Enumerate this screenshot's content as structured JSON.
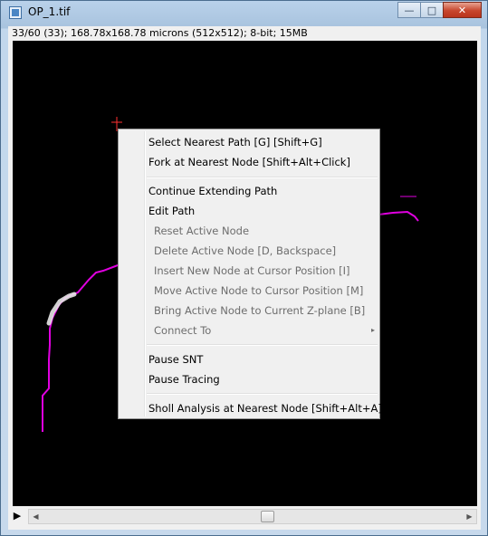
{
  "window": {
    "title": "OP_1.tif",
    "buttons": {
      "minimize": "—",
      "maximize": "□",
      "close": "✕"
    }
  },
  "status": "33/60 (33); 168.78x168.78 microns (512x512); 8-bit; 15MB",
  "canvas": {
    "background": "#000000",
    "path_color": "#e000e0",
    "crosshair_color": "#ff3030"
  },
  "controls": {
    "play_icon": "▶",
    "scroll_left_icon": "◀",
    "scroll_right_icon": "▶"
  },
  "context_menu": {
    "items": [
      {
        "label": "Select Nearest Path  [G] [Shift+G]",
        "enabled": true
      },
      {
        "label": "Fork at Nearest Node  [Shift+Alt+Click]",
        "enabled": true
      },
      {
        "label": "Continue Extending Path",
        "enabled": true
      },
      {
        "label": "Edit Path",
        "enabled": true
      },
      {
        "label": "Reset Active Node",
        "enabled": false
      },
      {
        "label": "Delete Active Node  [D, Backspace]",
        "enabled": false
      },
      {
        "label": "Insert New Node at Cursor Position  [I]",
        "enabled": false
      },
      {
        "label": "Move Active Node to Cursor Position  [M]",
        "enabled": false
      },
      {
        "label": "Bring Active Node to Current Z-plane  [B]",
        "enabled": false
      },
      {
        "label": "Connect To",
        "enabled": false,
        "submenu_icon": "▸"
      },
      {
        "label": "Pause SNT",
        "enabled": true
      },
      {
        "label": "Pause Tracing",
        "enabled": true
      },
      {
        "label": "Sholl Analysis at Nearest Node  [Shift+Alt+A]",
        "enabled": true
      }
    ]
  }
}
